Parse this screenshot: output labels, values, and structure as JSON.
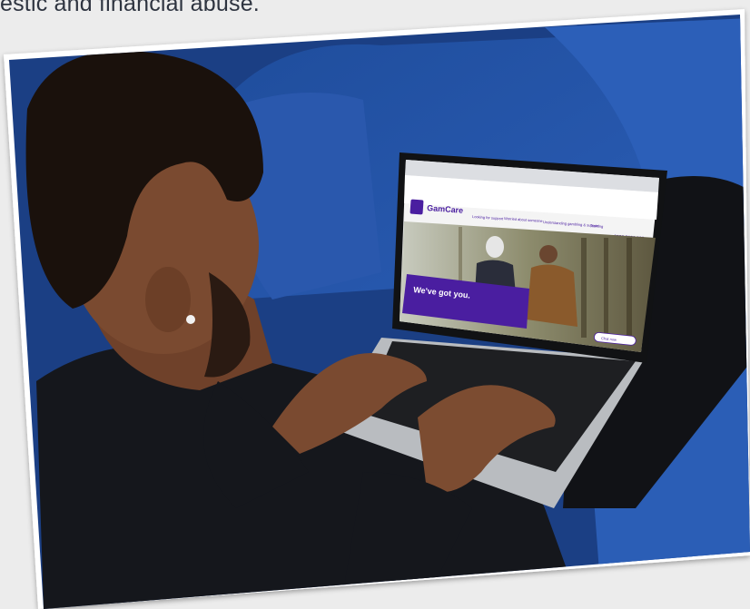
{
  "caption": "estic and financial abuse.",
  "photo": {
    "screen": {
      "logo_text": "GamCare",
      "nav_items": [
        "Looking for support",
        "Worried about someone",
        "Understanding gambling & support",
        "Training"
      ],
      "phone": "0808 8020 133",
      "hero_title": "We've got you.",
      "chat_label": "Chat now"
    }
  },
  "colors": {
    "sofa": "#2454a6",
    "brand_purple": "#4a1ea0",
    "shirt": "#15171c",
    "skin": "#7a4a30",
    "hair": "#1a110c",
    "laptop": "#b9bcc0"
  }
}
